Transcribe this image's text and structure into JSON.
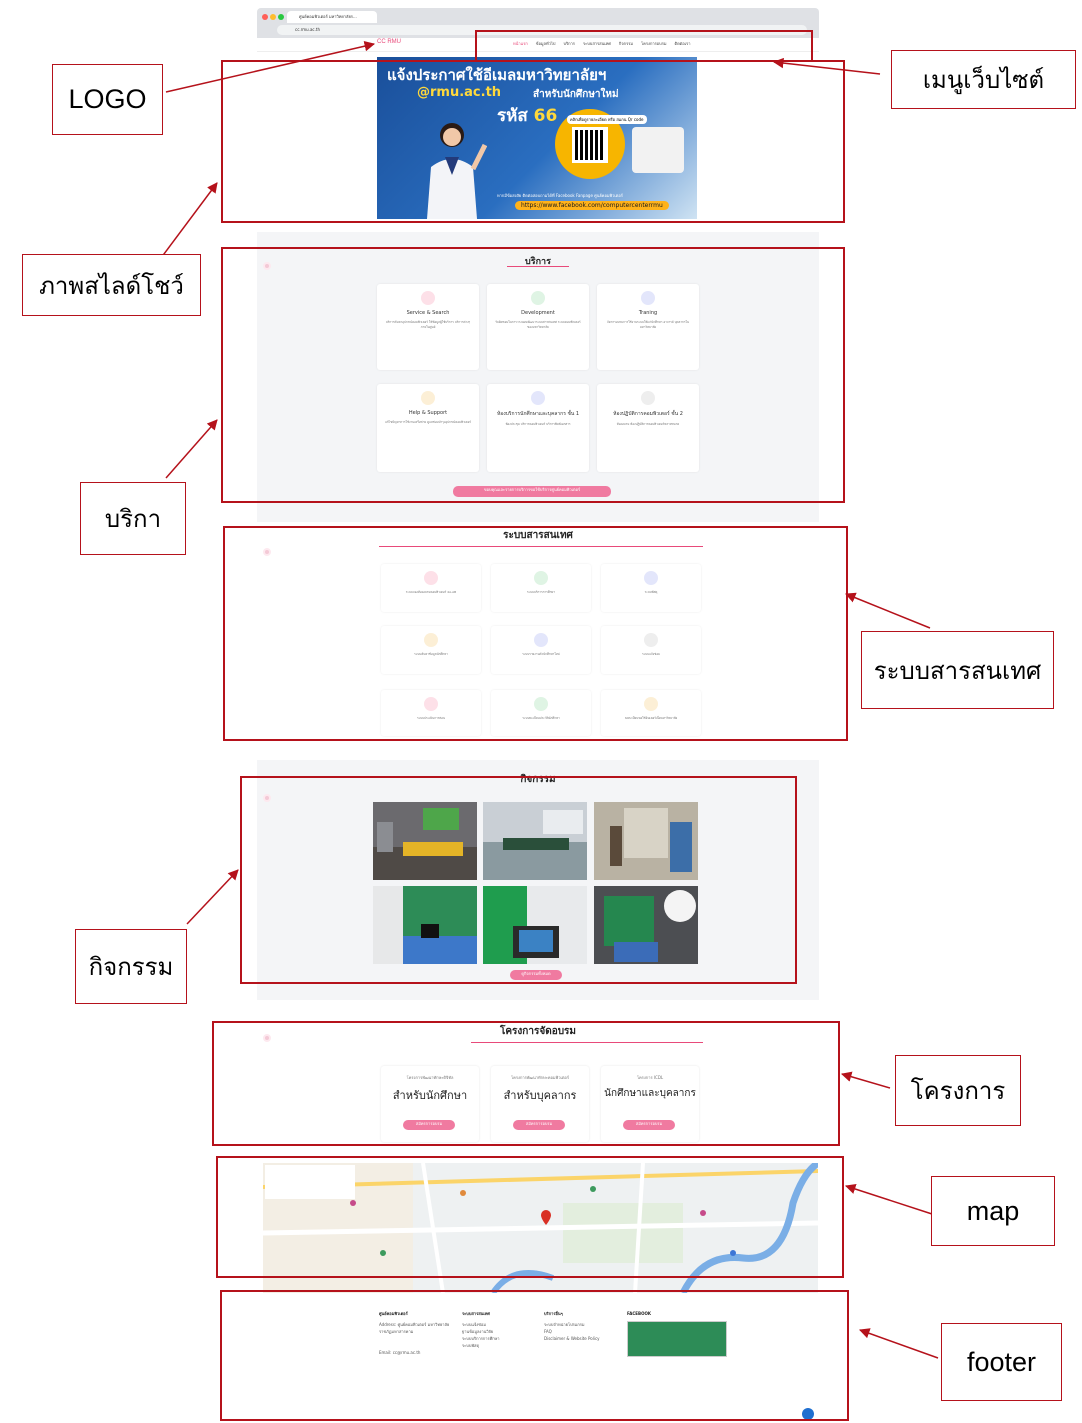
{
  "browser": {
    "tab_title": "ศูนย์คอมพิวเตอร์ มหาวิทยาลัยร...",
    "url": "cc.rmu.ac.th"
  },
  "site": {
    "logo": "CC RMU",
    "menu": [
      "หน้าแรก",
      "ข้อมูลทั่วไป",
      "บริการ",
      "ระบบสารสนเทศ",
      "กิจกรรม",
      "โครงการอบรม",
      "ติดต่อเรา"
    ]
  },
  "banner": {
    "line1": "แจ้งประกาศใช้อีเมลมหาวิทยาลัยฯ",
    "line2": "@rmu.ac.th",
    "line2b": "สำหรับนักศึกษาใหม่",
    "line3": "รหัส",
    "line3_code": "66",
    "qr_caption": "คลิกเพื่อดูรายละเอียด หรือ สแกน Qr code",
    "contact": "หากมีข้อสงสัย ติดต่อสอบถามได้ที่ Facebook Fanpage ศูนย์คอมพิวเตอร์",
    "link": "https://www.facebook.com/computercenterrmu"
  },
  "services": {
    "title": "บริการ",
    "cards": [
      {
        "title": "Service & Search",
        "desc": "บริการค้นหาอุปกรณ์คอมพิวเตอร์ ให้ข้อมูลผู้ใช้บริการ บริการต่างๆ ภายในศูนย์"
      },
      {
        "title": "Development",
        "desc": "รับผิดชอบในการวางแผนพัฒนาระบบสารสนเทศ ระบบคอมพิวเตอร์ของมหาวิทยาลัย"
      },
      {
        "title": "Traning",
        "desc": "จัดการอบรมการใช้งานระบบให้แก่นักศึกษา อาจารย์ บุคลากรในมหาวิทยาลัย"
      },
      {
        "title": "Help & Support",
        "desc": "แก้ไขปัญหาการใช้งานเครือข่าย ดูแลซ่อมบำรุงอุปกรณ์คอมพิวเตอร์"
      },
      {
        "title": "ห้องบริการนักศึกษาและบุคลากร ชั้น 1",
        "desc": "ห้องประชุม บริการคอมพิวเตอร์ บริการพิมพ์เอกสาร"
      },
      {
        "title": "ห้องปฏิบัติการคอมพิวเตอร์ ชั้น 2",
        "desc": "ห้องอบรม ห้องปฏิบัติการคอมพิวเตอร์หลายขนาด"
      }
    ],
    "button": "ขอบคุณและรายการบริการขอใช้บริการศูนย์คอมพิวเตอร์"
  },
  "systems": {
    "title": "ระบบสารสนเทศ",
    "items": [
      "ระบบจองห้องอบรมคอมพิวเตอร์ 4A-AB",
      "ระบบบริการการศึกษา",
      "ระบบพัสดุ",
      "ระบบค้นหาข้อมูลนักศึกษา",
      "ระบบรายงานตัวนักศึกษาใหม่",
      "ระบบแจ้งซ่อม",
      "ระบบประเมินการสอน",
      "ระบบทะเบียนประวัตินักศึกษา",
      "ลงทะเบียนขอใช้อินเตอร์เน็ตมหาวิทยาลัย"
    ]
  },
  "activities": {
    "title": "กิจกรรม",
    "button": "ดูกิจกรรมทั้งหมด"
  },
  "training": {
    "title": "โครงการจัดอบรม",
    "cards": [
      {
        "sub": "โครงการพัฒนาทักษะดิจิทัล",
        "big": "สำหรับนักศึกษา",
        "btn": "สมัครการอบรม"
      },
      {
        "sub": "โครงการพัฒนาทักษะคอมพิวเตอร์",
        "big": "สำหรับบุคลากร",
        "btn": "สมัครการอบรม"
      },
      {
        "sub": "โครงการ ICDL",
        "big": "นักศึกษาและบุคลากร",
        "btn": "สมัครการอบรม"
      }
    ]
  },
  "footer": {
    "col1_title": "ศูนย์คอมพิวเตอร์",
    "address_label": "Address:",
    "address": "ศูนย์คอมพิวเตอร์ มหาวิทยาลัยราชภัฏมหาสารคาม",
    "email_label": "Email:",
    "email": "cc@rmu.ac.th",
    "col2_title": "ระบบสารสนเทศ",
    "col2_items": [
      "ระบบแจ้งซ่อม",
      "ฐานข้อมูลงานวิจัย",
      "ระบบบริการการศึกษา",
      "ระบบพัสดุ"
    ],
    "col3_title": "บริการอื่นๆ",
    "col3_items": [
      "ระบบจำหน่ายโปรแกรม",
      "FAQ",
      "Disclaimer & Website Policy"
    ],
    "col4_title": "FACEBOOK"
  },
  "annotations": {
    "logo": "LOGO",
    "menu": "เมนูเว็บไซต์",
    "slideshow": "ภาพสไลด์โชว์",
    "services": "บริกา",
    "systems": "ระบบสารสนเทศ",
    "activities": "กิจกรรม",
    "projects": "โครงการ",
    "map": "map",
    "footer": "footer"
  },
  "colors": {
    "accent": "#e84a7a",
    "annotation": "#b5121b"
  }
}
